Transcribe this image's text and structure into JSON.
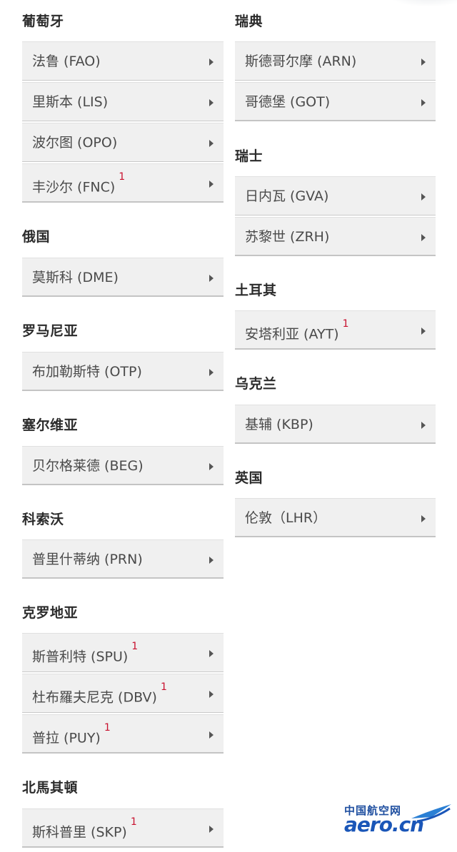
{
  "left_column": [
    {
      "country": "葡萄牙",
      "airports": [
        {
          "name": "法鲁 (FAO)",
          "note": ""
        },
        {
          "name": "里斯本 (LIS)",
          "note": ""
        },
        {
          "name": "波尔图 (OPO)",
          "note": ""
        },
        {
          "name": "丰沙尔 (FNC)",
          "note": "1"
        }
      ]
    },
    {
      "country": "俄国",
      "airports": [
        {
          "name": "莫斯科 (DME)",
          "note": ""
        }
      ]
    },
    {
      "country": "罗马尼亚",
      "airports": [
        {
          "name": "布加勒斯特 (OTP)",
          "note": ""
        }
      ]
    },
    {
      "country": "塞尔维亚",
      "airports": [
        {
          "name": "贝尔格莱德 (BEG)",
          "note": ""
        }
      ]
    },
    {
      "country": "科索沃",
      "airports": [
        {
          "name": "普里什蒂纳 (PRN)",
          "note": ""
        }
      ]
    },
    {
      "country": "克罗地亚",
      "airports": [
        {
          "name": "斯普利特 (SPU)",
          "note": "1"
        },
        {
          "name": "杜布羅夫尼克 (DBV)",
          "note": "1"
        },
        {
          "name": "普拉 (PUY)",
          "note": "1"
        }
      ]
    },
    {
      "country": "北馬其頓",
      "airports": [
        {
          "name": "斯科普里 (SKP)",
          "note": "1"
        }
      ]
    }
  ],
  "right_column": [
    {
      "country": "瑞典",
      "airports": [
        {
          "name": "斯德哥尔摩 (ARN)",
          "note": ""
        },
        {
          "name": "哥德堡 (GOT)",
          "note": ""
        }
      ]
    },
    {
      "country": "瑞士",
      "airports": [
        {
          "name": "日内瓦 (GVA)",
          "note": ""
        },
        {
          "name": "苏黎世 (ZRH)",
          "note": ""
        }
      ]
    },
    {
      "country": "土耳其",
      "airports": [
        {
          "name": "安塔利亚 (AYT)",
          "note": "1"
        }
      ]
    },
    {
      "country": "乌克兰",
      "airports": [
        {
          "name": "基辅 (KBP)",
          "note": ""
        }
      ]
    },
    {
      "country": "英国",
      "airports": [
        {
          "name": "伦敦（LHR）",
          "note": ""
        }
      ]
    }
  ],
  "watermark": {
    "cn": "中国航空网",
    "en": "aero.cn"
  },
  "colors": {
    "item_bg": "#f0f0f0",
    "note_red": "#c8102e",
    "watermark_blue": "#1a56b8"
  },
  "icons": {
    "chevron": "chevron-right-icon"
  }
}
